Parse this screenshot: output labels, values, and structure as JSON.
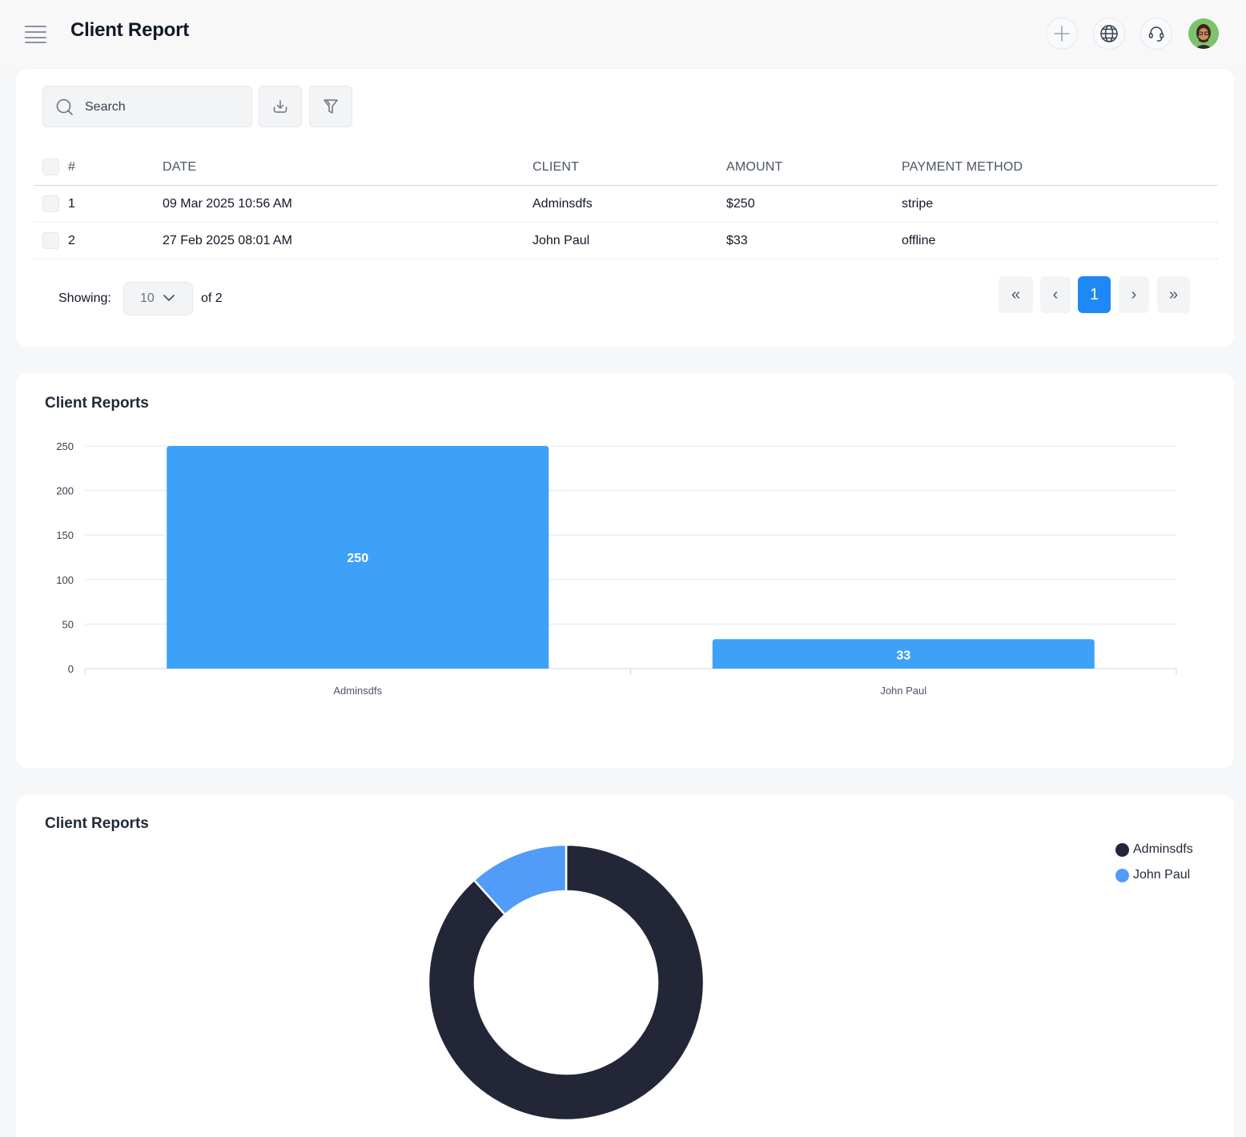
{
  "header": {
    "title": "Client Report",
    "icons": [
      "menu-icon",
      "plus-icon",
      "globe-icon",
      "headset-icon",
      "user-avatar"
    ]
  },
  "toolbar": {
    "search_placeholder": "Search",
    "export_icon": "download-icon",
    "filter_icon": "filter-icon"
  },
  "table": {
    "columns": [
      "#",
      "DATE",
      "CLIENT",
      "AMOUNT",
      "PAYMENT METHOD"
    ],
    "rows": [
      {
        "num": "1",
        "date": "09 Mar 2025 10:56 AM",
        "client": "Adminsdfs",
        "amount": "$250",
        "method": "stripe"
      },
      {
        "num": "2",
        "date": "27 Feb 2025 08:01 AM",
        "client": "John Paul",
        "amount": "$33",
        "method": "offline"
      }
    ]
  },
  "pagination": {
    "showing_label": "Showing:",
    "per_page": "10",
    "of_label": "of 2",
    "first": "«",
    "prev": "‹",
    "current": "1",
    "next": "›",
    "last": "»"
  },
  "colors": {
    "accent": "#1e88f5",
    "bar": "#3da1f7",
    "donut_dark": "#222636",
    "donut_blue": "#519bf9"
  },
  "chart_data": [
    {
      "type": "bar",
      "title": "Client Reports",
      "categories": [
        "Adminsdfs",
        "John Paul"
      ],
      "values": [
        250,
        33
      ],
      "ylim": [
        0,
        250
      ],
      "yticks": [
        0,
        50,
        100,
        150,
        200,
        250
      ],
      "data_labels": true,
      "grid": true
    },
    {
      "type": "pie",
      "variant": "donut",
      "title": "Client Reports",
      "labels": [
        "Adminsdfs",
        "John Paul"
      ],
      "values": [
        250,
        33
      ],
      "colors": [
        "#222636",
        "#519bf9"
      ],
      "legend": "top-right"
    }
  ]
}
